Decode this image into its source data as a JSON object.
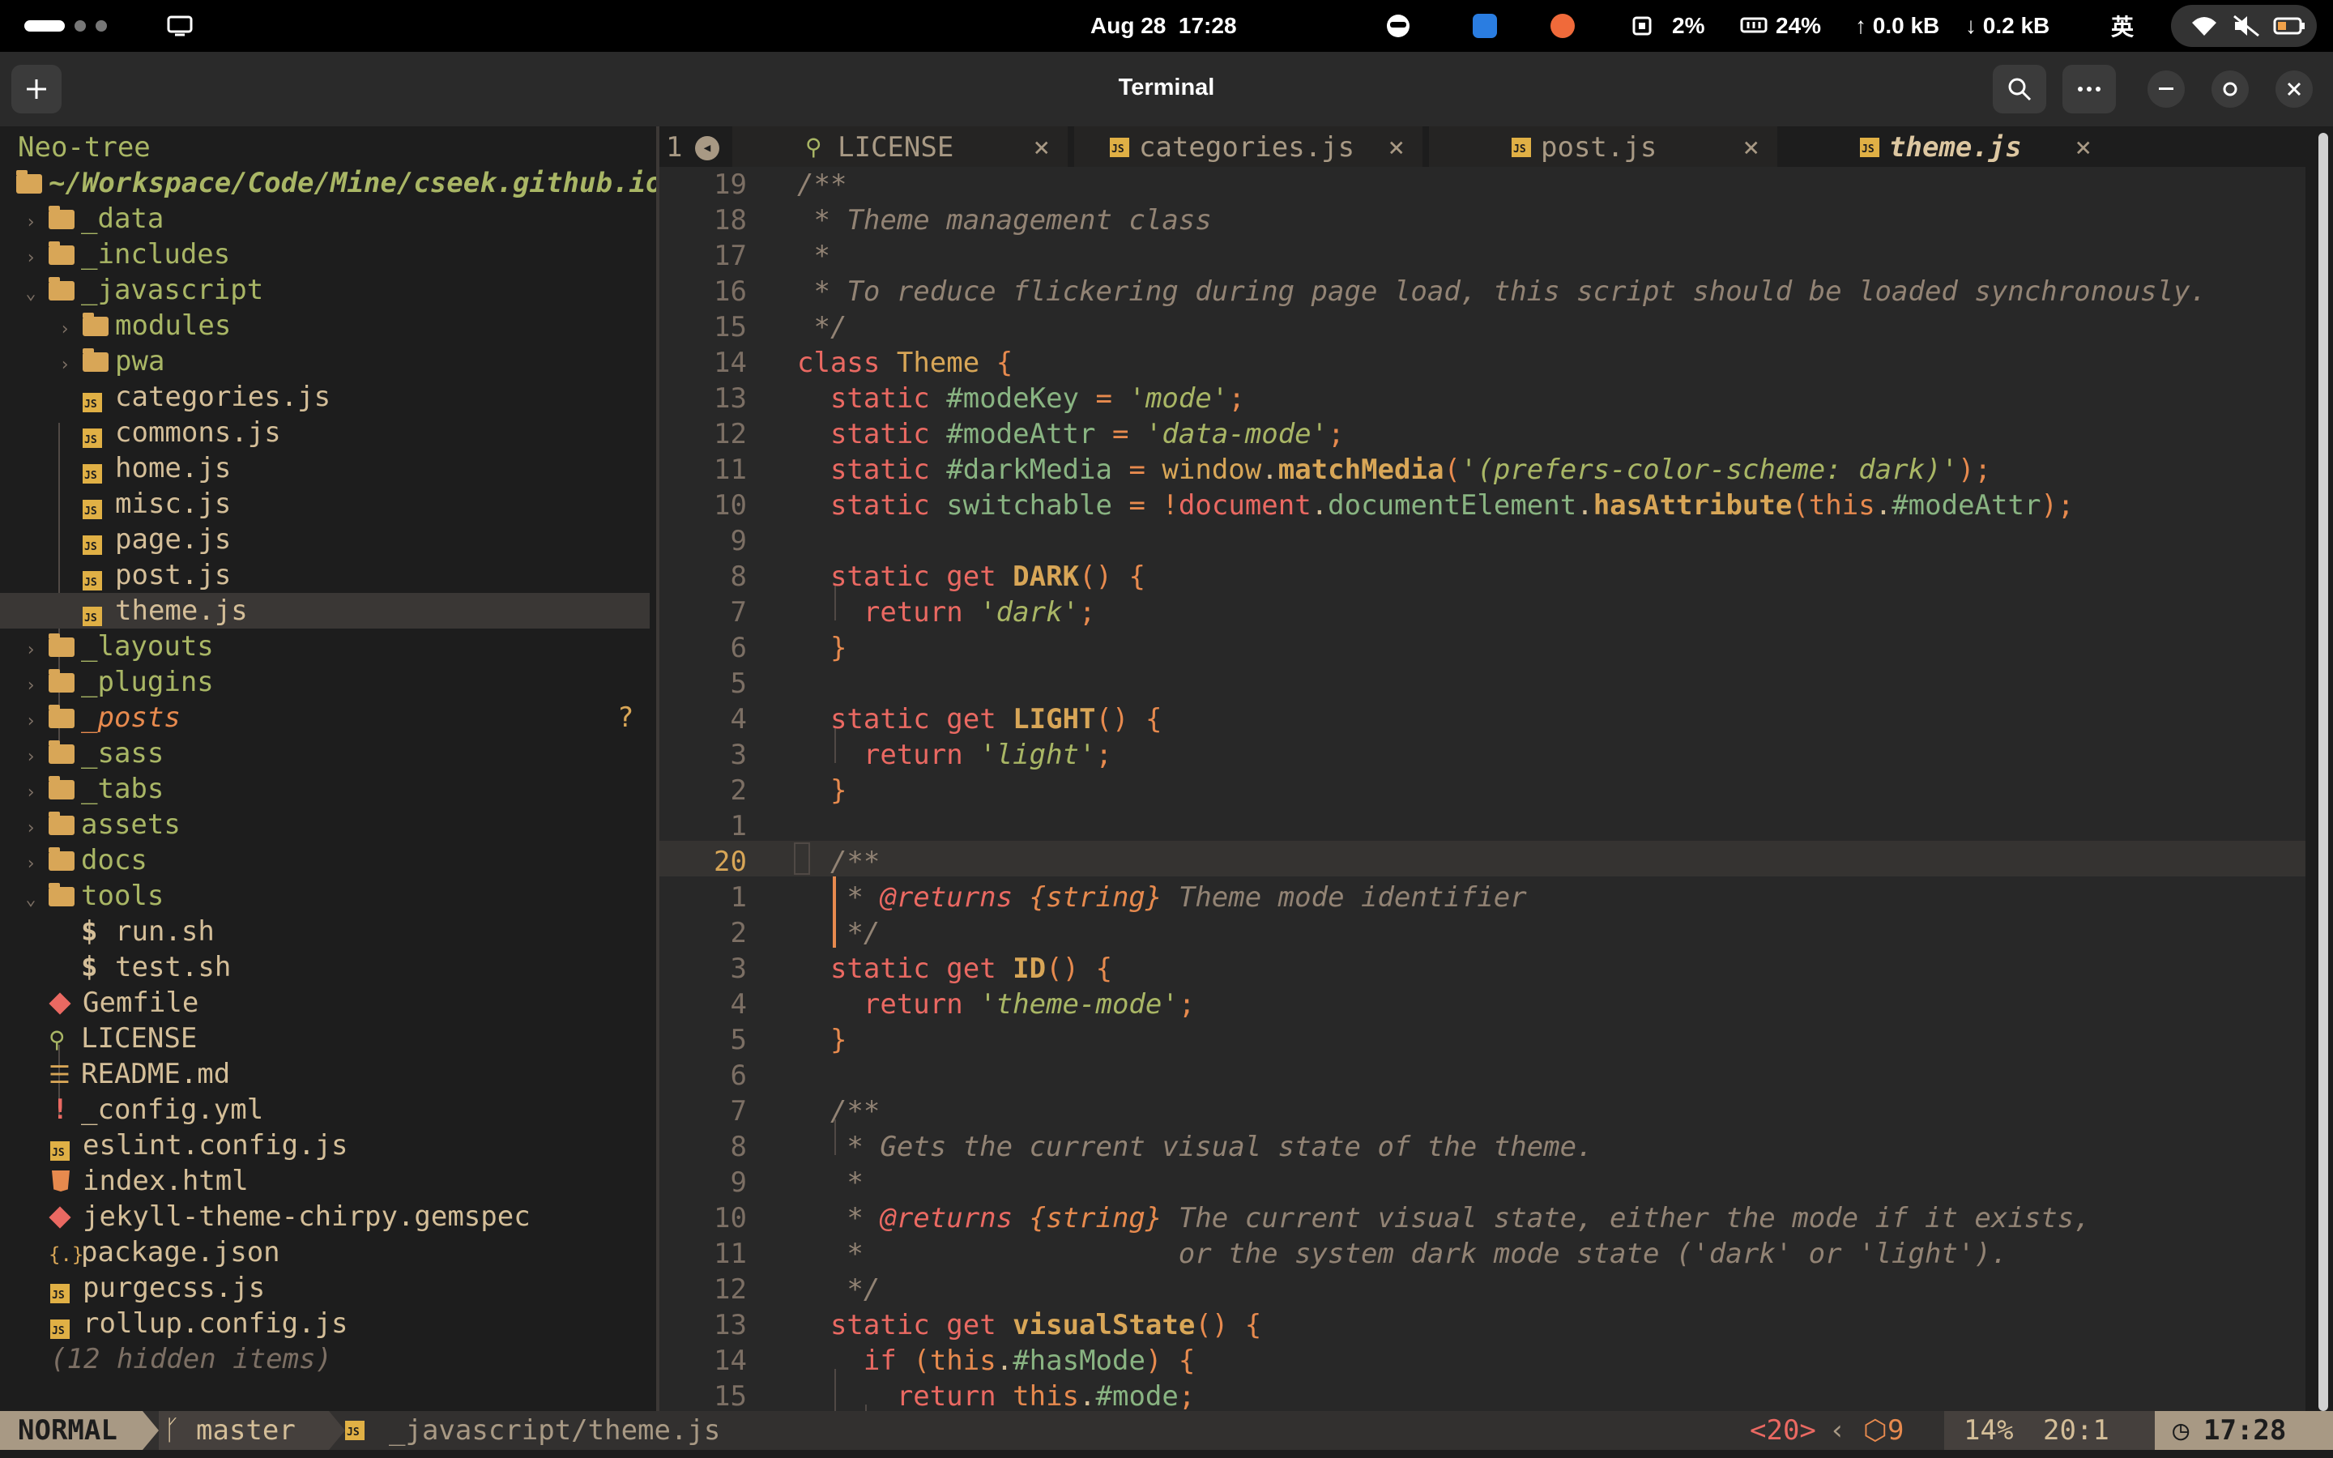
{
  "topbar": {
    "datetime": "Aug 28  17:28",
    "cpu": "2%",
    "mem": "24%",
    "net_up": "↑ 0.0 kB",
    "net_down": "↓ 0.2 kB",
    "input_method": "英"
  },
  "window": {
    "title": "Terminal"
  },
  "sidebar": {
    "title": "Neo-tree",
    "root": "~/Workspace/Code/Mine/cseek.github.io",
    "hidden": "(12 hidden items)",
    "posts_status": "?",
    "items": [
      {
        "label": "_data",
        "kind": "dir"
      },
      {
        "label": "_includes",
        "kind": "dir"
      },
      {
        "label": "_javascript",
        "kind": "dir-open"
      },
      {
        "label": "modules",
        "kind": "dir"
      },
      {
        "label": "pwa",
        "kind": "dir"
      },
      {
        "label": "categories.js",
        "kind": "js"
      },
      {
        "label": "commons.js",
        "kind": "js"
      },
      {
        "label": "home.js",
        "kind": "js"
      },
      {
        "label": "misc.js",
        "kind": "js"
      },
      {
        "label": "page.js",
        "kind": "js"
      },
      {
        "label": "post.js",
        "kind": "js"
      },
      {
        "label": "theme.js",
        "kind": "js"
      },
      {
        "label": "_layouts",
        "kind": "dir"
      },
      {
        "label": "_plugins",
        "kind": "dir"
      },
      {
        "label": "_posts",
        "kind": "dir"
      },
      {
        "label": "_sass",
        "kind": "dir"
      },
      {
        "label": "_tabs",
        "kind": "dir"
      },
      {
        "label": "assets",
        "kind": "dir"
      },
      {
        "label": "docs",
        "kind": "dir"
      },
      {
        "label": "tools",
        "kind": "dir-open"
      },
      {
        "label": "run.sh",
        "kind": "sh"
      },
      {
        "label": "test.sh",
        "kind": "sh"
      },
      {
        "label": "Gemfile",
        "kind": "ruby"
      },
      {
        "label": "LICENSE",
        "kind": "license"
      },
      {
        "label": "README.md",
        "kind": "md"
      },
      {
        "label": "_config.yml",
        "kind": "yml"
      },
      {
        "label": "eslint.config.js",
        "kind": "js"
      },
      {
        "label": "index.html",
        "kind": "html"
      },
      {
        "label": "jekyll-theme-chirpy.gemspec",
        "kind": "ruby"
      },
      {
        "label": "package.json",
        "kind": "json"
      },
      {
        "label": "purgecss.js",
        "kind": "js"
      },
      {
        "label": "rollup.config.js",
        "kind": "js"
      }
    ]
  },
  "tabline": {
    "buffer_num": "1",
    "tabs": [
      "LICENSE",
      "categories.js",
      "post.js",
      "theme.js"
    ],
    "close": "×"
  },
  "editor": {
    "line_numbers": [
      "19",
      "18",
      "17",
      "16",
      "15",
      "14",
      "13",
      "12",
      "11",
      "10",
      "9",
      "8",
      "7",
      "6",
      "5",
      "4",
      "3",
      "2",
      "1",
      "20",
      "1",
      "2",
      "3",
      "4",
      "5",
      "6",
      "7",
      "8",
      "9",
      "10",
      "11",
      "12",
      "13",
      "14",
      "15"
    ],
    "lines": [
      "/**",
      " * Theme management class",
      " *",
      " * To reduce flickering during page load, this script should be loaded synchronously.",
      " */",
      "class Theme {",
      "  static #modeKey = 'mode';",
      "  static #modeAttr = 'data-mode';",
      "  static #darkMedia = window.matchMedia('(prefers-color-scheme: dark)');",
      "  static switchable = !document.documentElement.hasAttribute(this.#modeAttr);",
      "",
      "  static get DARK() {",
      "    return 'dark';",
      "  }",
      "",
      "  static get LIGHT() {",
      "    return 'light';",
      "  }",
      "",
      "  /**",
      "   * @returns {string} Theme mode identifier",
      "   */",
      "  static get ID() {",
      "    return 'theme-mode';",
      "  }",
      "",
      "  /**",
      "   * Gets the current visual state of the theme.",
      "   *",
      "   * @returns {string} The current visual state, either the mode if it exists,",
      "   *                   or the system dark mode state ('dark' or 'light').",
      "   */",
      "  static get visualState() {",
      "    if (this.#hasMode) {",
      "      return this.#mode;"
    ]
  },
  "statusline": {
    "mode": "NORMAL",
    "branch": "master",
    "file": "_javascript/theme.js",
    "mark": "<20>",
    "diag": "9",
    "progress": "14%",
    "position": "20:1",
    "time": "17:28"
  },
  "colors": {
    "accent": "#d8a657",
    "keyword": "#ea6962",
    "string": "#a9b665",
    "comment": "#928374",
    "background": "#282828"
  }
}
